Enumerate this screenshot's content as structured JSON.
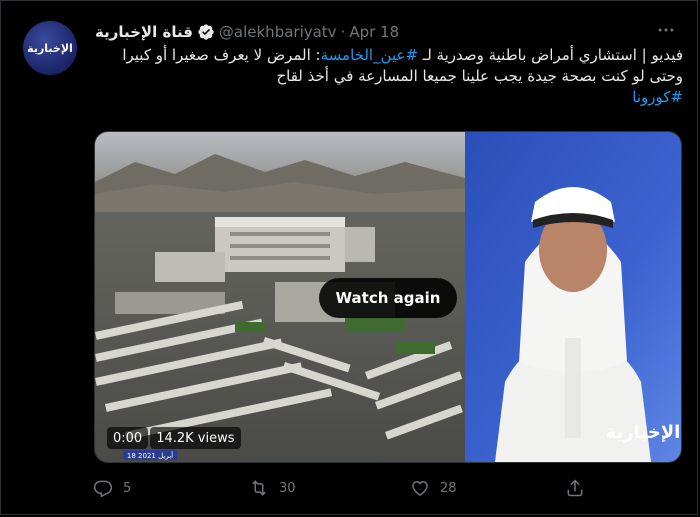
{
  "tweet": {
    "display_name": "قناة الإخبارية",
    "handle": "@alekhbariyatv",
    "separator": "·",
    "date": "Apr 18",
    "avatar_text": "الإخبارية",
    "text_part1": "فيديو | استشاري أمراض باطنية وصدرية لـ ",
    "hashtag1": "#عين_الخامسة",
    "text_part2": ": المرض لا يعرف صغيرا أو كبيرا وحتى لو كنت بصحة جيدة يجب علينا جميعا المسارعة في أخذ لقاح",
    "hashtag2": "#كورونا"
  },
  "media": {
    "watch_again_label": "Watch again",
    "time": "0:00",
    "views": "14.2K views",
    "channel_logo": "الإخبارية",
    "date_overlay": "18 أبريل 2021"
  },
  "actions": {
    "reply_count": "5",
    "retweet_count": "30",
    "like_count": "28"
  },
  "colors": {
    "background": "#000000",
    "text": "#e7e9ea",
    "muted": "#71767b",
    "link": "#1d9bf0",
    "verified": "#1d9bf0"
  },
  "icons": {
    "reply": "reply-icon",
    "retweet": "retweet-icon",
    "like": "heart-icon",
    "share": "share-icon",
    "more": "more-icon",
    "verified": "verified-badge-icon"
  }
}
